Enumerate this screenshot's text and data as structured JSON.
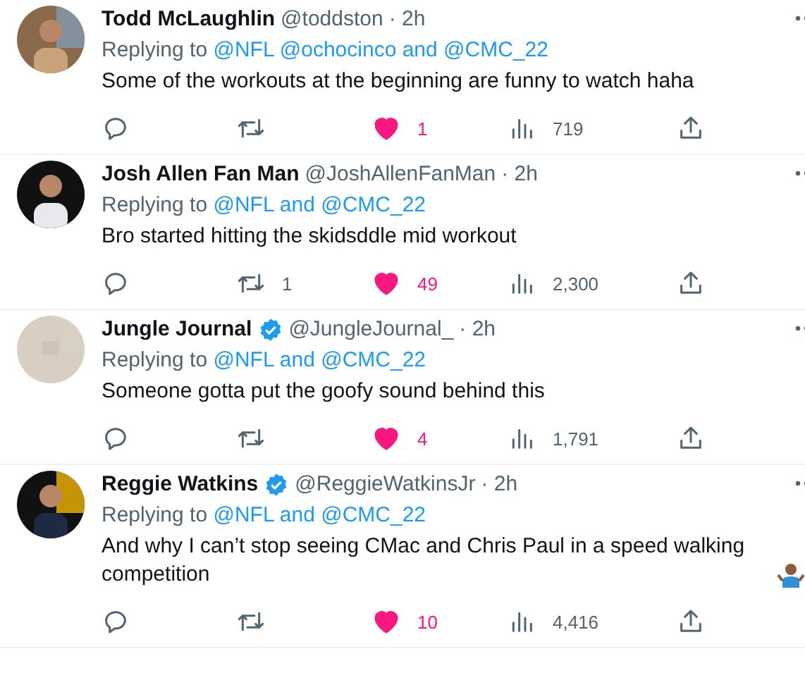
{
  "replies": [
    {
      "name": "Todd McLaughlin",
      "verified": false,
      "handle": "@toddston",
      "time": "· 2h",
      "replying_label": "Replying to",
      "replying_to": "@NFL @ochocinco and @CMC_22",
      "text": "Some of the workouts at the beginning are funny to watch haha",
      "has_emoji": false,
      "liked": true,
      "likes": "1",
      "views": "719"
    },
    {
      "name": "Josh Allen Fan Man",
      "verified": false,
      "handle": "@JoshAllenFanMan",
      "time": "· 2h",
      "replying_label": "Replying to",
      "replying_to": "@NFL and @CMC_22",
      "text": "Bro started hitting the skidsddle mid workout",
      "has_emoji": false,
      "retweets": "1",
      "liked": true,
      "likes": "49",
      "views": "2,300"
    },
    {
      "name": "Jungle Journal",
      "verified": true,
      "handle": "@JungleJournal_",
      "time": "· 2h",
      "replying_label": "Replying to",
      "replying_to": "@NFL and @CMC_22",
      "text": "Someone gotta put the goofy sound behind this",
      "has_emoji": false,
      "liked": true,
      "likes": "4",
      "views": "1,791"
    },
    {
      "name": "Reggie Watkins",
      "verified": true,
      "handle": "@ReggieWatkinsJr",
      "time": "· 2h",
      "replying_label": "Replying to",
      "replying_to": "@NFL and @CMC_22",
      "text": "And why I can’t stop seeing CMac and Chris Paul in a speed walking competition",
      "has_emoji": true,
      "liked": true,
      "likes": "10",
      "views": "4,416"
    }
  ]
}
